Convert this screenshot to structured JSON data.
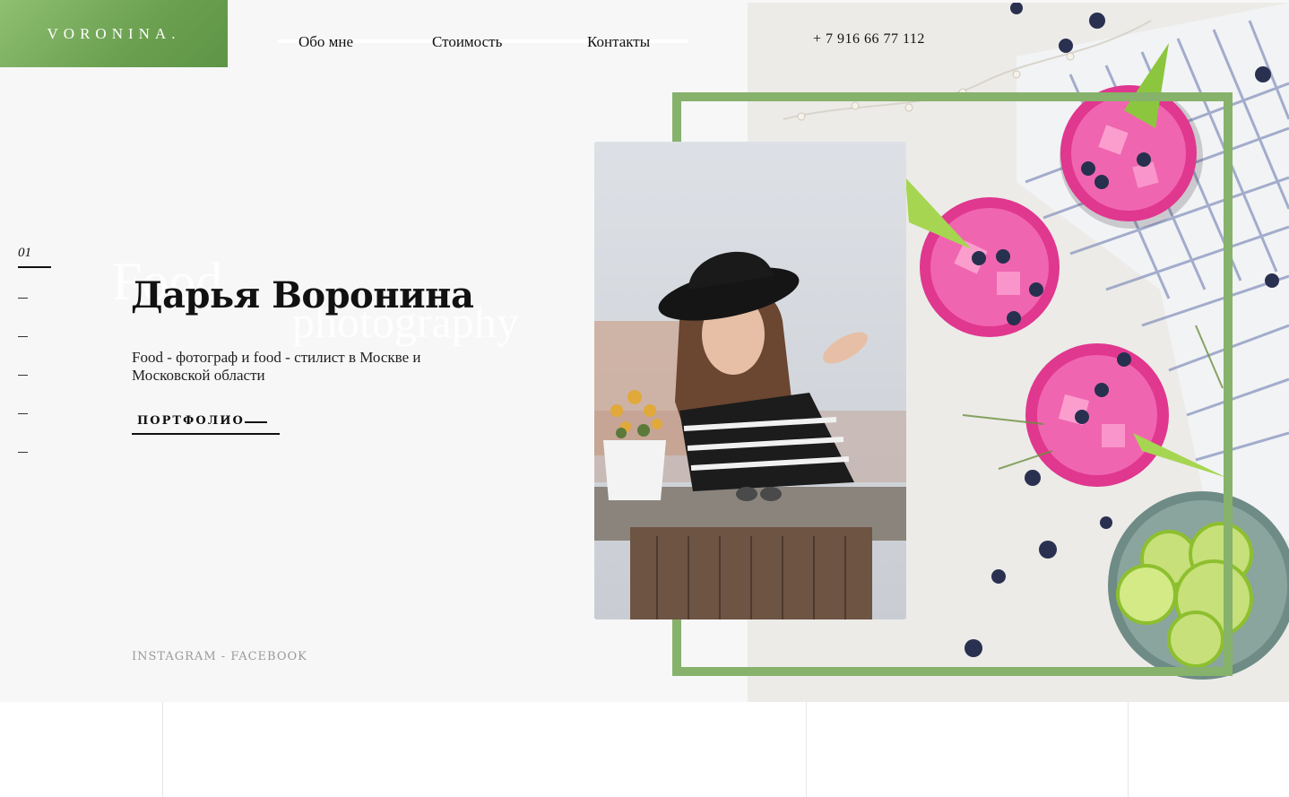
{
  "header": {
    "logo": "VORONINA.",
    "nav": [
      "Обо мне",
      "Стоимость",
      "Контакты"
    ],
    "phone": "+ 7 916 66 77 112"
  },
  "pager": {
    "current": "01",
    "dash": "—"
  },
  "hero": {
    "background_word_1": "Food",
    "background_word_2": "photography",
    "title": "Дарья Воронина",
    "subtitle": "Food - фотограф и food - стилист в Москве и Московской области",
    "button_label": "ПОРТФОЛИО"
  },
  "social": {
    "instagram": "INSTAGRAM",
    "separator": " - ",
    "facebook": "FACEBOOK"
  },
  "colors": {
    "accent_green": "#86b26b",
    "text": "#111111",
    "muted": "#9a9a9a",
    "hero_background": "#f7f7f7"
  }
}
